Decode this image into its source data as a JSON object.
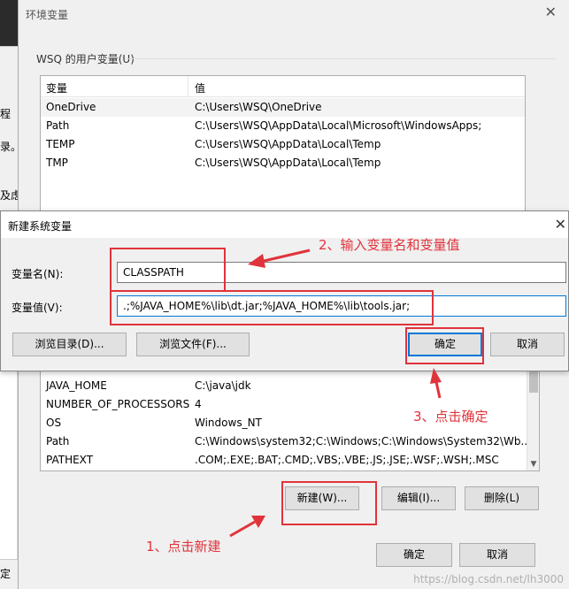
{
  "background_window": {
    "fragments": [
      "程",
      "录。",
      "及虑",
      "定"
    ]
  },
  "env_window": {
    "title": "环境变量",
    "user_group_label": "WSQ 的用户变量(U)",
    "user_vars": {
      "columns": [
        "变量",
        "值"
      ],
      "rows": [
        {
          "name": "OneDrive",
          "value": "C:\\Users\\WSQ\\OneDrive"
        },
        {
          "name": "Path",
          "value": "C:\\Users\\WSQ\\AppData\\Local\\Microsoft\\WindowsApps;"
        },
        {
          "name": "TEMP",
          "value": "C:\\Users\\WSQ\\AppData\\Local\\Temp"
        },
        {
          "name": "TMP",
          "value": "C:\\Users\\WSQ\\AppData\\Local\\Temp"
        }
      ]
    },
    "system_vars": {
      "rows": [
        {
          "name": "JAVA_HOME",
          "value": "C:\\java\\jdk"
        },
        {
          "name": "NUMBER_OF_PROCESSORS",
          "value": "4"
        },
        {
          "name": "OS",
          "value": "Windows_NT"
        },
        {
          "name": "Path",
          "value": "C:\\Windows\\system32;C:\\Windows;C:\\Windows\\System32\\Wb..."
        },
        {
          "name": "PATHEXT",
          "value": ".COM;.EXE;.BAT;.CMD;.VBS;.VBE;.JS;.JSE;.WSF;.WSH;.MSC"
        }
      ]
    },
    "buttons": {
      "new": "新建(W)...",
      "edit": "编辑(I)...",
      "delete": "删除(L)",
      "ok": "确定",
      "cancel": "取消"
    }
  },
  "dialog": {
    "title": "新建系统变量",
    "name_label": "变量名(N):",
    "name_value": "CLASSPATH",
    "value_label": "变量值(V):",
    "value_value": ".;%JAVA_HOME%\\lib\\dt.jar;%JAVA_HOME%\\lib\\tools.jar;",
    "buttons": {
      "browse_dir": "浏览目录(D)...",
      "browse_file": "浏览文件(F)...",
      "ok": "确定",
      "cancel": "取消"
    }
  },
  "annotations": {
    "step1": "1、点击新建",
    "step2": "2、输入变量名和变量值",
    "step3": "3、点击确定",
    "color": "#e0333b"
  },
  "watermark": "https://blog.csdn.net/lh3000"
}
